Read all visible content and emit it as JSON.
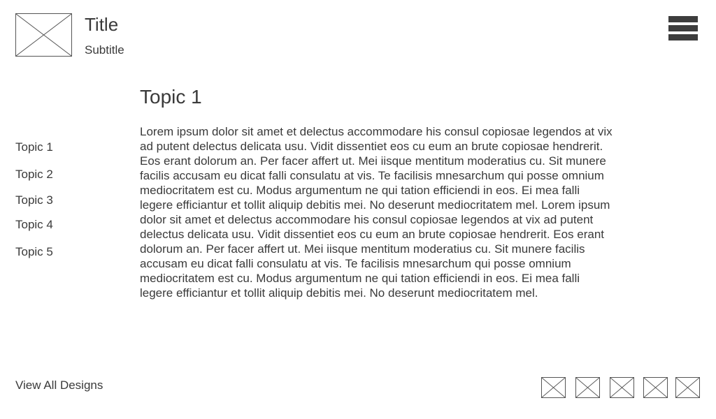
{
  "header": {
    "title": "Title",
    "subtitle": "Subtitle",
    "logo_icon": "image-placeholder-icon",
    "menu_icon": "hamburger-menu-icon"
  },
  "sidebar": {
    "items": [
      {
        "label": "Topic 1"
      },
      {
        "label": "Topic 2"
      },
      {
        "label": "Topic 3"
      },
      {
        "label": "Topic 4"
      },
      {
        "label": "Topic 5"
      }
    ]
  },
  "main": {
    "heading": "Topic 1",
    "body": "Lorem ipsum dolor sit amet et delectus accommodare his consul copiosae legendos at vix ad putent delectus delicata usu. Vidit dissentiet eos cu eum an brute copiosae hendrerit. Eos erant dolorum an. Per facer affert ut. Mei iisque mentitum moderatius cu. Sit munere facilis accusam eu dicat falli consulatu at vis. Te facilisis mnesarchum qui posse omnium mediocritatem est cu. Modus argumentum ne qui tation efficiendi in eos. Ei mea falli legere efficiantur et tollit aliquip debitis mei. No deserunt mediocritatem mel. Lorem ipsum dolor sit amet et delectus accommodare his consul copiosae legendos at vix ad putent delectus delicata usu. Vidit dissentiet eos cu eum an brute copiosae hendrerit. Eos erant dolorum an. Per facer affert ut. Mei iisque mentitum moderatius cu. Sit munere facilis accusam eu dicat falli consulatu at vis. Te facilisis mnesarchum qui posse omnium mediocritatem est cu. Modus argumentum ne qui tation efficiendi in eos. Ei mea falli legere efficiantur et tollit aliquip debitis mei. No deserunt mediocritatem mel."
  },
  "footer": {
    "view_all_label": "View All Designs",
    "thumbnail_icon": "image-placeholder-icon"
  },
  "colors": {
    "text": "#3a3a3a",
    "border": "#555555",
    "menu": "#3d3d3d",
    "background": "#ffffff"
  }
}
